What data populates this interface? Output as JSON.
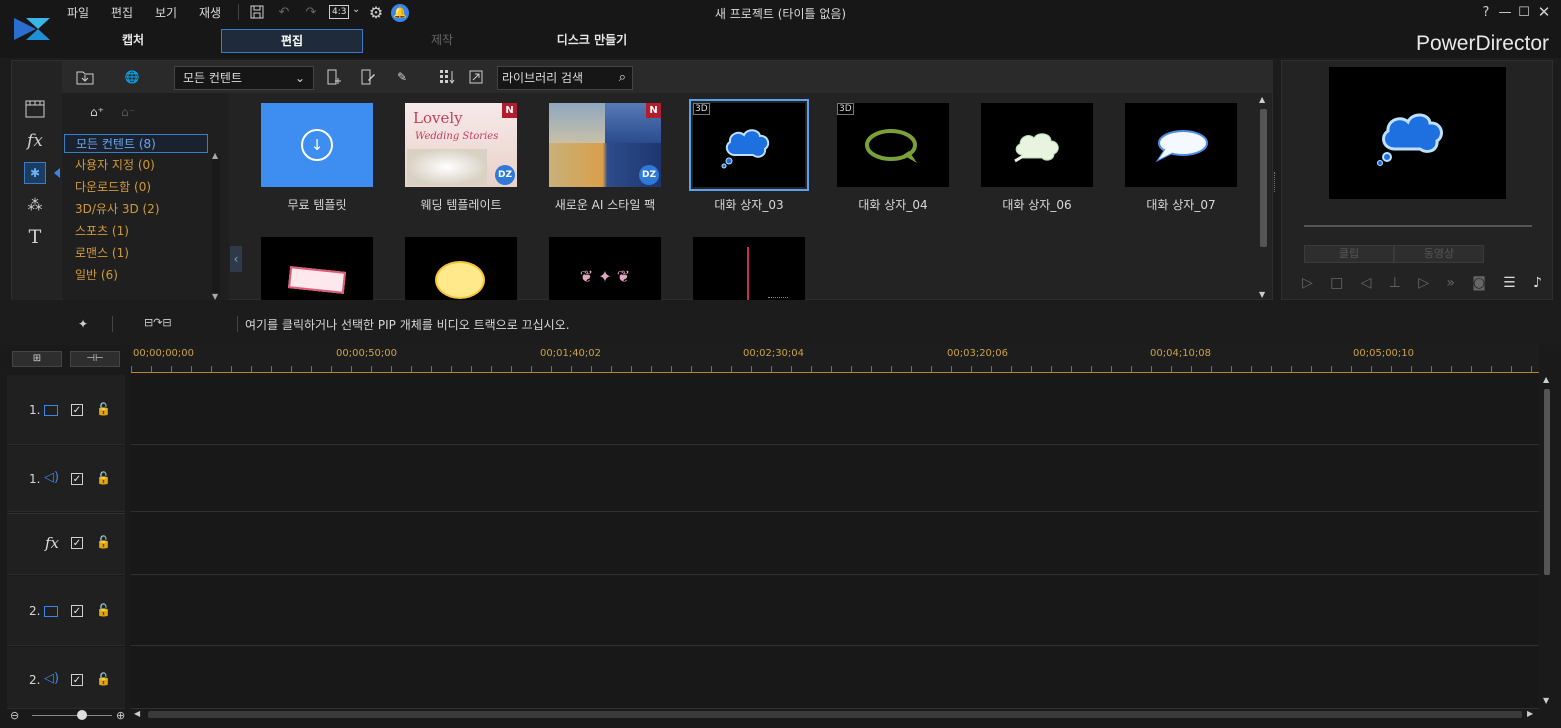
{
  "app": {
    "name": "PowerDirector",
    "window_title": "새 프로젝트 (타이틀 없음)",
    "accent": "#3a7cc6"
  },
  "menu": [
    "파일",
    "편집",
    "보기",
    "재생"
  ],
  "aspect_ratio": "4:3",
  "tabs": [
    {
      "label": "캡처",
      "state": "normal"
    },
    {
      "label": "편집",
      "state": "active"
    },
    {
      "label": "제작",
      "state": "disabled"
    },
    {
      "label": "디스크 만들기",
      "state": "normal"
    }
  ],
  "library": {
    "content_filter": "모든 컨텐트",
    "search_placeholder": "라이브러리 검색",
    "categories": [
      {
        "label": "모든 컨텐트  (8)",
        "selected": true
      },
      {
        "label": "사용자 지정  (0)"
      },
      {
        "label": "다운로드함  (0)"
      },
      {
        "label": "3D/유사 3D  (2)"
      },
      {
        "label": "스포츠  (1)"
      },
      {
        "label": "로맨스  (1)"
      },
      {
        "label": "일반  (6)"
      }
    ],
    "items": [
      {
        "label": "무료 템플릿"
      },
      {
        "label": "웨딩 템플레이트",
        "thumb_text_1": "Lovely",
        "thumb_text_2": "Wedding Stories",
        "badge": "N",
        "corner": "DZ"
      },
      {
        "label": "새로운 AI 스타일 팩",
        "badge": "N",
        "corner": "DZ"
      },
      {
        "label": "대화 상자_03",
        "tag": "3D",
        "selected": true
      },
      {
        "label": "대화 상자_04",
        "tag": "3D"
      },
      {
        "label": "대화 상자_06"
      },
      {
        "label": "대화 상자_07"
      }
    ]
  },
  "preview": {
    "clip_label": "클립",
    "movie_label": "동영상"
  },
  "midbar": {
    "hint": "여기를 클릭하거나 선택한 PIP 개체를 비디오 트랙으로 끄십시오."
  },
  "timeline": {
    "timecodes": [
      "00;00;00;00",
      "00;00;50;00",
      "00;01;40;02",
      "00;02;30;04",
      "00;03;20;06",
      "00;04;10;08",
      "00;05;00;10"
    ],
    "tracks": [
      {
        "num": "1.",
        "kind": "video"
      },
      {
        "num": "1.",
        "kind": "audio"
      },
      {
        "num": "",
        "kind": "fx",
        "fx_label": "fx"
      },
      {
        "num": "2.",
        "kind": "video"
      },
      {
        "num": "2.",
        "kind": "audio"
      }
    ]
  }
}
